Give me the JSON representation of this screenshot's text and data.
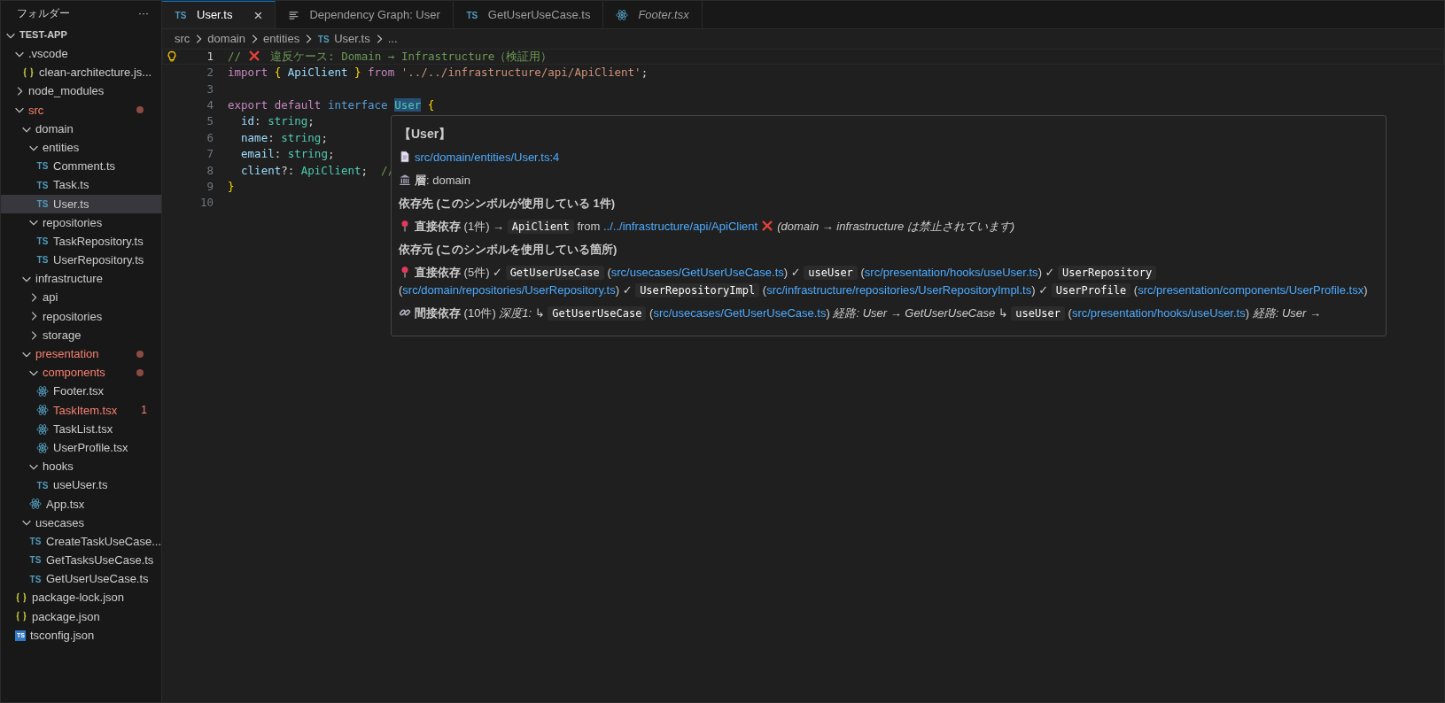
{
  "sidebar": {
    "title": "フォルダー",
    "more": "···",
    "root": {
      "label": "TEST-APP",
      "expanded": true
    },
    "tree": [
      {
        "label": ".vscode",
        "kind": "folder",
        "expanded": true,
        "selected": false,
        "problem": false,
        "children": [
          {
            "label": "clean-architecture.js...",
            "kind": "json",
            "selected": false,
            "problem": false
          }
        ]
      },
      {
        "label": "node_modules",
        "kind": "folder",
        "expanded": false,
        "selected": false,
        "problem": false
      },
      {
        "label": "src",
        "kind": "folder",
        "expanded": true,
        "selected": false,
        "problem": true,
        "children": [
          {
            "label": "domain",
            "kind": "folder",
            "expanded": true,
            "selected": false,
            "problem": false,
            "children": [
              {
                "label": "entities",
                "kind": "folder",
                "expanded": true,
                "selected": false,
                "problem": false,
                "children": [
                  {
                    "label": "Comment.ts",
                    "kind": "ts",
                    "icon_text": "TS",
                    "selected": false,
                    "problem": false
                  },
                  {
                    "label": "Task.ts",
                    "kind": "ts",
                    "icon_text": "TS",
                    "selected": false,
                    "problem": false
                  },
                  {
                    "label": "User.ts",
                    "kind": "ts",
                    "icon_text": "TS",
                    "selected": true,
                    "problem": false
                  }
                ]
              },
              {
                "label": "repositories",
                "kind": "folder",
                "expanded": true,
                "selected": false,
                "problem": false,
                "children": [
                  {
                    "label": "TaskRepository.ts",
                    "kind": "ts",
                    "icon_text": "TS",
                    "selected": false,
                    "problem": false
                  },
                  {
                    "label": "UserRepository.ts",
                    "kind": "ts",
                    "icon_text": "TS",
                    "selected": false,
                    "problem": false
                  }
                ]
              }
            ]
          },
          {
            "label": "infrastructure",
            "kind": "folder",
            "expanded": true,
            "selected": false,
            "problem": false,
            "children": [
              {
                "label": "api",
                "kind": "folder",
                "expanded": false,
                "selected": false,
                "problem": false
              },
              {
                "label": "repositories",
                "kind": "folder",
                "expanded": false,
                "selected": false,
                "problem": false
              },
              {
                "label": "storage",
                "kind": "folder",
                "expanded": false,
                "selected": false,
                "problem": false
              }
            ]
          },
          {
            "label": "presentation",
            "kind": "folder",
            "expanded": true,
            "selected": false,
            "problem": true,
            "children": [
              {
                "label": "components",
                "kind": "folder",
                "expanded": true,
                "selected": false,
                "problem": true,
                "children": [
                  {
                    "label": "Footer.tsx",
                    "kind": "react",
                    "selected": false,
                    "problem": false
                  },
                  {
                    "label": "TaskItem.tsx",
                    "kind": "react",
                    "selected": false,
                    "problem": true,
                    "badge": "1"
                  },
                  {
                    "label": "TaskList.tsx",
                    "kind": "react",
                    "selected": false,
                    "problem": false
                  },
                  {
                    "label": "UserProfile.tsx",
                    "kind": "react",
                    "selected": false,
                    "problem": false
                  }
                ]
              },
              {
                "label": "hooks",
                "kind": "folder",
                "expanded": true,
                "selected": false,
                "problem": false,
                "children": [
                  {
                    "label": "useUser.ts",
                    "kind": "ts",
                    "icon_text": "TS",
                    "selected": false,
                    "problem": false
                  }
                ]
              },
              {
                "label": "App.tsx",
                "kind": "react",
                "selected": false,
                "problem": false
              }
            ]
          },
          {
            "label": "usecases",
            "kind": "folder",
            "expanded": true,
            "selected": false,
            "problem": false,
            "children": [
              {
                "label": "CreateTaskUseCase...",
                "kind": "ts",
                "icon_text": "TS",
                "selected": false,
                "problem": false
              },
              {
                "label": "GetTasksUseCase.ts",
                "kind": "ts",
                "icon_text": "TS",
                "selected": false,
                "problem": false
              },
              {
                "label": "GetUserUseCase.ts",
                "kind": "ts",
                "icon_text": "TS",
                "selected": false,
                "problem": false
              }
            ]
          }
        ]
      },
      {
        "label": "package-lock.json",
        "kind": "json",
        "selected": false,
        "problem": false
      },
      {
        "label": "package.json",
        "kind": "json",
        "selected": false,
        "problem": false
      },
      {
        "label": "tsconfig.json",
        "kind": "tsconfig",
        "icon_text": "TS",
        "selected": false,
        "problem": false
      }
    ]
  },
  "tabs": [
    {
      "label": "User.ts",
      "kind": "ts",
      "icon_text": "TS",
      "selected": true,
      "preview": false,
      "close": "×"
    },
    {
      "label": "Dependency Graph: User",
      "kind": "doc",
      "selected": false,
      "preview": false
    },
    {
      "label": "GetUserUseCase.ts",
      "kind": "ts",
      "icon_text": "TS",
      "selected": false,
      "preview": false
    },
    {
      "label": "Footer.tsx",
      "kind": "react",
      "selected": false,
      "preview": true
    }
  ],
  "breadcrumb": [
    {
      "label": "src",
      "kind": "folder"
    },
    {
      "label": "domain",
      "kind": "folder"
    },
    {
      "label": "entities",
      "kind": "folder"
    },
    {
      "label": "User.ts",
      "kind": "ts",
      "icon_text": "TS"
    },
    {
      "label": "...",
      "kind": "symbol"
    }
  ],
  "code": [
    {
      "n": "1",
      "current": true,
      "lightbulb": true,
      "tokens": [
        {
          "kind": "comment",
          "s": "// "
        },
        {
          "kind": "cross"
        },
        {
          "kind": "comment",
          "s": " 違反ケース: Domain → Infrastructure（検証用）"
        }
      ]
    },
    {
      "n": "2",
      "current": false,
      "lightbulb": false,
      "tokens": [
        {
          "kind": "keyword",
          "s": "import"
        },
        {
          "kind": "brace",
          "s": " {"
        },
        {
          "kind": "var",
          "s": " ApiClient "
        },
        {
          "kind": "brace",
          "s": "}"
        },
        {
          "kind": "keyword",
          "s": " from"
        },
        {
          "kind": "string",
          "s": " '../../infrastructure/api/ApiClient'"
        },
        {
          "kind": "plain",
          "s": ";"
        }
      ]
    },
    {
      "n": "3",
      "current": false,
      "lightbulb": false
    },
    {
      "n": "4",
      "current": false,
      "lightbulb": false,
      "tokens": [
        {
          "kind": "keyword",
          "s": "export default"
        },
        {
          "kind": "storage",
          "s": " interface "
        },
        {
          "kind": "type",
          "s": "User",
          "hover": true
        },
        {
          "kind": "brace",
          "s": " {"
        }
      ]
    },
    {
      "n": "5",
      "current": false,
      "lightbulb": false,
      "tokens": [
        {
          "kind": "var",
          "s": "  id"
        },
        {
          "kind": "plain",
          "s": ": "
        },
        {
          "kind": "type",
          "s": "string"
        },
        {
          "kind": "plain",
          "s": ";"
        }
      ]
    },
    {
      "n": "6",
      "current": false,
      "lightbulb": false,
      "tokens": [
        {
          "kind": "var",
          "s": "  name"
        },
        {
          "kind": "plain",
          "s": ": "
        },
        {
          "kind": "type",
          "s": "string"
        },
        {
          "kind": "plain",
          "s": ";"
        }
      ]
    },
    {
      "n": "7",
      "current": false,
      "lightbulb": false,
      "tokens": [
        {
          "kind": "var",
          "s": "  email"
        },
        {
          "kind": "plain",
          "s": ": "
        },
        {
          "kind": "type",
          "s": "string"
        },
        {
          "kind": "plain",
          "s": ";"
        }
      ]
    },
    {
      "n": "8",
      "current": false,
      "lightbulb": false,
      "tokens": [
        {
          "kind": "var",
          "s": "  client"
        },
        {
          "kind": "plain",
          "s": "?: "
        },
        {
          "kind": "type",
          "s": "ApiClient"
        },
        {
          "kind": "plain",
          "s": ";  "
        },
        {
          "kind": "comment",
          "s": "//"
        }
      ]
    },
    {
      "n": "9",
      "current": false,
      "lightbulb": false,
      "tokens": [
        {
          "kind": "brace",
          "s": "}"
        }
      ]
    },
    {
      "n": "10",
      "current": false,
      "lightbulb": false
    }
  ],
  "hover": {
    "title": "【User】",
    "lines": [
      {
        "kind": "para",
        "segs": [
          {
            "kind": "doc"
          },
          {
            "kind": "link",
            "s": "src/domain/entities/User.ts:4"
          }
        ]
      },
      {
        "kind": "para",
        "segs": [
          {
            "kind": "bank"
          },
          {
            "kind": "bold",
            "s": "層"
          },
          {
            "kind": "text",
            "s": ": domain"
          }
        ]
      },
      {
        "kind": "heading",
        "segs": [
          {
            "kind": "text",
            "s": "依存先 (このシンボルが使用している 1件)"
          }
        ]
      },
      {
        "kind": "para",
        "segs": [
          {
            "kind": "pin"
          },
          {
            "kind": "bold",
            "s": "直接依存"
          },
          {
            "kind": "text",
            "s": " (1件) → "
          },
          {
            "kind": "code",
            "s": "ApiClient"
          },
          {
            "kind": "text",
            "s": " from "
          },
          {
            "kind": "link",
            "s": "../../infrastructure/api/ApiClient"
          },
          {
            "kind": "cross"
          },
          {
            "kind": "italic",
            "s": "(domain → infrastructure は禁止されています)"
          }
        ]
      },
      {
        "kind": "heading",
        "segs": [
          {
            "kind": "text",
            "s": "依存元 (このシンボルを使用している箇所)"
          }
        ]
      },
      {
        "kind": "para",
        "segs": [
          {
            "kind": "pin"
          },
          {
            "kind": "bold",
            "s": "直接依存"
          },
          {
            "kind": "text",
            "s": " (5件) ✓ "
          },
          {
            "kind": "code",
            "s": "GetUserUseCase"
          },
          {
            "kind": "text",
            "s": " ("
          },
          {
            "kind": "link",
            "s": "src/usecases/GetUserUseCase.ts"
          },
          {
            "kind": "text",
            "s": ") ✓ "
          },
          {
            "kind": "code",
            "s": "useUser"
          },
          {
            "kind": "text",
            "s": " ("
          },
          {
            "kind": "link",
            "s": "src/presentation/hooks/useUser.ts"
          },
          {
            "kind": "text",
            "s": ") ✓ "
          },
          {
            "kind": "code",
            "s": "UserRepository"
          },
          {
            "kind": "text",
            "s": " ("
          },
          {
            "kind": "link",
            "s": "src/domain/repositories/UserRepository.ts"
          },
          {
            "kind": "text",
            "s": ") ✓ "
          },
          {
            "kind": "code",
            "s": "UserRepositoryImpl"
          },
          {
            "kind": "text",
            "s": " ("
          },
          {
            "kind": "link",
            "s": "src/infrastructure/repositories/UserRepositoryImpl.ts"
          },
          {
            "kind": "text",
            "s": ") ✓ "
          },
          {
            "kind": "code",
            "s": "UserProfile"
          },
          {
            "kind": "text",
            "s": " ("
          },
          {
            "kind": "link",
            "s": "src/presentation/components/UserProfile.tsx"
          },
          {
            "kind": "text",
            "s": ")"
          }
        ]
      },
      {
        "kind": "para",
        "segs": [
          {
            "kind": "chain"
          },
          {
            "kind": "bold",
            "s": "間接依存"
          },
          {
            "kind": "text",
            "s": " (10件) "
          },
          {
            "kind": "italic",
            "s": "深度1: ↳ "
          },
          {
            "kind": "code",
            "s": "GetUserUseCase"
          },
          {
            "kind": "text",
            "s": " ("
          },
          {
            "kind": "link",
            "s": "src/usecases/GetUserUseCase.ts"
          },
          {
            "kind": "text",
            "s": ") "
          },
          {
            "kind": "italic",
            "s": "経路: User → GetUserUseCase ↳ "
          },
          {
            "kind": "code",
            "s": "useUser"
          },
          {
            "kind": "text",
            "s": " ("
          },
          {
            "kind": "link",
            "s": "src/presentation/hooks/useUser.ts"
          },
          {
            "kind": "text",
            "s": ") "
          },
          {
            "kind": "italic",
            "s": "経路: User →"
          }
        ]
      }
    ]
  }
}
